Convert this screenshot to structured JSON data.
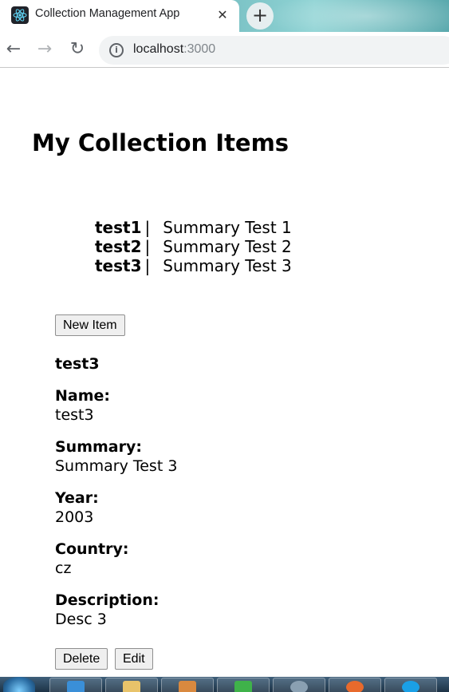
{
  "browser": {
    "tab_title": "Collection Management App",
    "tab_close_glyph": "✕",
    "new_tab_glyph": "+",
    "favicon": "react-icon",
    "url_host": "localhost",
    "url_port": ":3000",
    "nav": {
      "back_glyph": "←",
      "forward_glyph": "→",
      "reload_glyph": "↻",
      "info_glyph": "i"
    }
  },
  "page": {
    "title": "My Collection Items",
    "items": [
      {
        "name": "test1",
        "separator": "|",
        "summary": "Summary Test 1"
      },
      {
        "name": "test2",
        "separator": "|",
        "summary": "Summary Test 2"
      },
      {
        "name": "test3",
        "separator": "|",
        "summary": "Summary Test 3"
      }
    ],
    "new_item_button": "New Item",
    "detail": {
      "heading": "test3",
      "name_label": "Name:",
      "name_value": "test3",
      "summary_label": "Summary:",
      "summary_value": "Summary Test 3",
      "year_label": "Year:",
      "year_value": "2003",
      "country_label": "Country:",
      "country_value": "cz",
      "description_label": "Description:",
      "description_value": "Desc 3"
    },
    "delete_button": "Delete",
    "edit_button": "Edit"
  },
  "taskbar": {
    "start": "windows-start-orb",
    "apps": [
      "internet-explorer-icon",
      "file-explorer-icon",
      "app-icon",
      "tasks-checkmark-icon",
      "globe-icon",
      "firefox-icon",
      "skype-icon"
    ]
  },
  "colors": {
    "tab_strip": "#6fb8bc",
    "omnibox_bg": "#f1f3f4",
    "button_bg": "#efefef",
    "button_border": "#8f8f8f",
    "taskbar": "#1d3346"
  }
}
